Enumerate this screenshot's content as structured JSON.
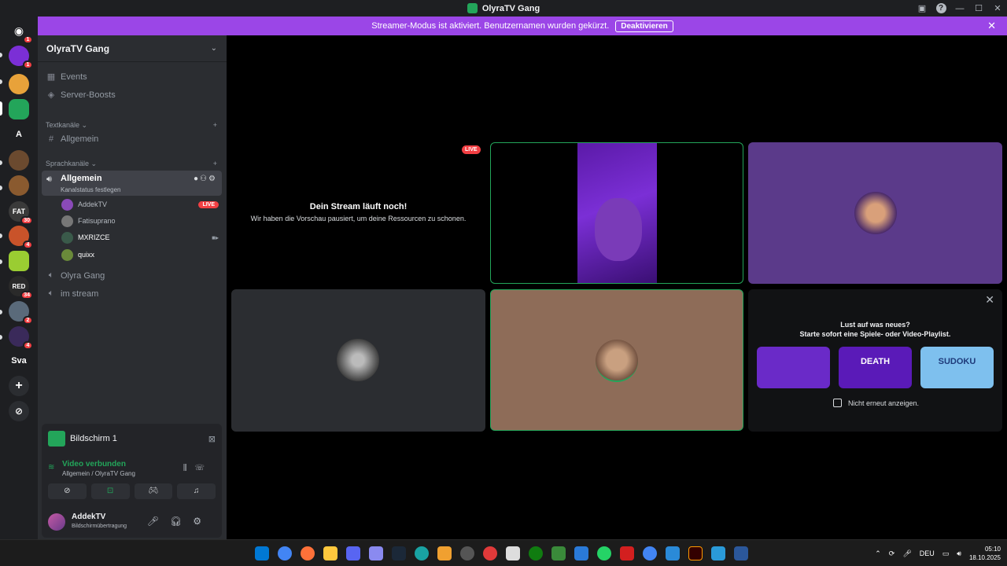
{
  "window": {
    "title": "OlyraTV Gang"
  },
  "banner": {
    "text": "Streamer-Modus ist aktiviert. Benutzernamen wurden gekürzt.",
    "button": "Deaktivieren"
  },
  "rail": {
    "servers": [
      {
        "label": "",
        "badge": "1",
        "color": "#5865f2"
      },
      {
        "label": "",
        "badge": "1",
        "color": "#7b2fd6"
      },
      {
        "label": "",
        "badge": "",
        "color": "#e8a23a"
      },
      {
        "label": "",
        "badge": "",
        "color": "#23a55a"
      },
      {
        "label": "A",
        "badge": "",
        "color": "#1e1f22"
      },
      {
        "label": "",
        "badge": "",
        "color": "#6b4a2f"
      },
      {
        "label": "",
        "badge": "",
        "color": "#8a5a2f"
      },
      {
        "label": "FAT",
        "badge": "30",
        "color": "#3a3a3a"
      },
      {
        "label": "",
        "badge": "4",
        "color": "#c9532a"
      },
      {
        "label": "",
        "badge": "",
        "color": "#9acd32"
      },
      {
        "label": "RED",
        "badge": "34",
        "color": "#2a2a2a"
      },
      {
        "label": "",
        "badge": "2",
        "color": "#5a6a7a"
      },
      {
        "label": "",
        "badge": "4",
        "color": "#3a2a5a"
      },
      {
        "label": "Sva",
        "badge": "",
        "color": "#1e1f22"
      }
    ]
  },
  "sidebar": {
    "server_name": "OlyraTV Gang",
    "top_items": [
      "Events",
      "Server-Boosts"
    ],
    "text_category": "Textkanäle",
    "text_channels": [
      "Allgemein"
    ],
    "voice_category": "Sprachkanäle",
    "active_voice": {
      "name": "Allgemein",
      "status": "Kanalstatus festlegen"
    },
    "members": [
      {
        "name": "AddekTV",
        "live": "LIVE",
        "color": "#8a4ab8"
      },
      {
        "name": "Fatisuprano",
        "live": "",
        "color": "#777"
      },
      {
        "name": "MXRIZCE",
        "live": "",
        "color": "#3a5a4a"
      },
      {
        "name": "quixx",
        "live": "",
        "color": "#6a8a3a"
      }
    ],
    "other_voice": [
      "Olyra Gang",
      "im stream"
    ]
  },
  "panel": {
    "screen": "Bildschirm 1",
    "connected": "Video verbunden",
    "location": "Allgemein / OlyraTV Gang",
    "user": "AddekTV",
    "user_status": "Bildschirmübertragung"
  },
  "stage": {
    "paused_title": "Dein Stream läuft noch!",
    "paused_text": "Wir haben die Vorschau pausiert, um deine Ressourcen zu schonen.",
    "live": "LIVE"
  },
  "promo": {
    "line1": "Lust auf was neues?",
    "line2": "Starte sofort eine Spiele- oder Video-Playlist.",
    "games": [
      {
        "label": "",
        "color": "#6a2ac8"
      },
      {
        "label": "DEATH",
        "color": "#5a1ab8"
      },
      {
        "label": "SUDOKU",
        "color": "#7ec0ee"
      }
    ],
    "checkbox": "Nicht erneut anzeigen."
  },
  "taskbar": {
    "lang": "DEU",
    "time": "05:10",
    "date": "18.10.2025"
  }
}
